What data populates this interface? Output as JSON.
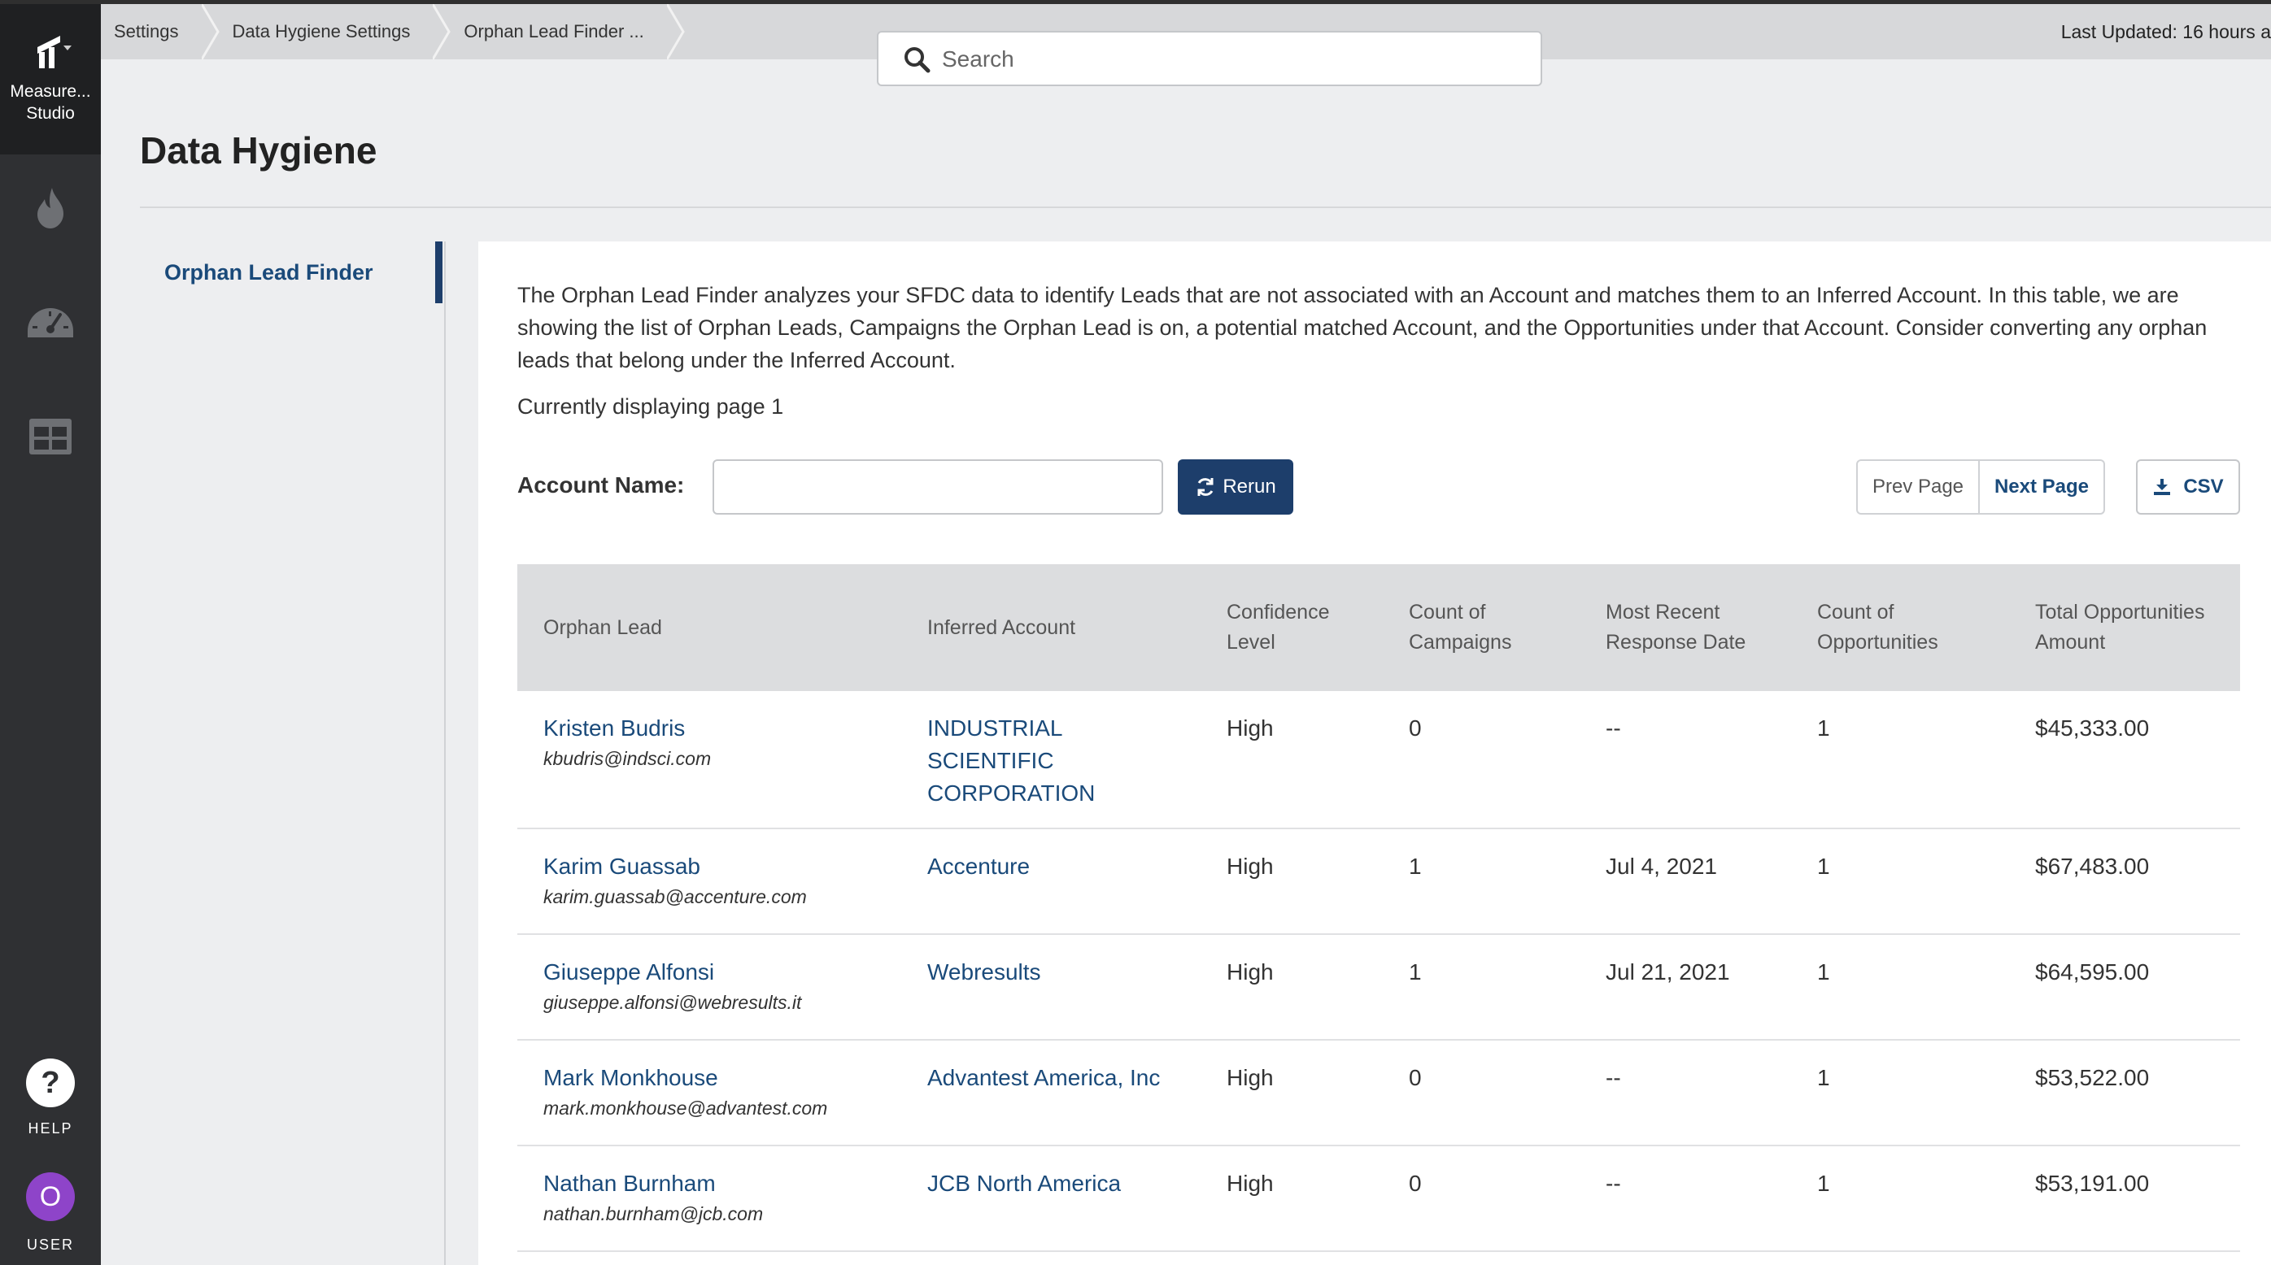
{
  "brand": {
    "name_line1": "Measure...",
    "name_line2": "Studio"
  },
  "rail": {
    "help_label": "HELP",
    "user_initial": "O",
    "user_label": "USER"
  },
  "breadcrumbs": [
    "Settings",
    "Data Hygiene Settings",
    "Orphan Lead Finder ..."
  ],
  "last_updated": "Last Updated: 16 hours a",
  "search": {
    "placeholder": "Search",
    "value": ""
  },
  "page_title": "Data Hygiene",
  "submenu": {
    "active_item": "Orphan Lead Finder"
  },
  "description": "The Orphan Lead Finder analyzes your SFDC data to identify Leads that are not associated with an Account and matches them to an Inferred Account. In this table, we are showing the list of Orphan Leads, Campaigns the Orphan Lead is on, a potential matched Account, and the Opportunities under that Account. Consider converting any orphan leads that belong under the Inferred Account.",
  "page_status": "Currently displaying page 1",
  "filters": {
    "account_label": "Account Name:",
    "account_value": "",
    "rerun_label": "Rerun"
  },
  "pagination": {
    "prev_label": "Prev Page",
    "next_label": "Next Page"
  },
  "export": {
    "csv_label": "CSV"
  },
  "table": {
    "columns": [
      "Orphan Lead",
      "Inferred Account",
      "Confidence Level",
      "Count of Campaigns",
      "Most Recent Response Date",
      "Count of Opportunities",
      "Total Opportunities Amount"
    ],
    "rows": [
      {
        "lead": "Kristen Budris",
        "email": "kbudris@indsci.com",
        "account": "INDUSTRIAL SCIENTIFIC CORPORATION",
        "confidence": "High",
        "campaigns": "0",
        "response_date": "--",
        "opportunities": "1",
        "amount": "$45,333.00"
      },
      {
        "lead": "Karim Guassab",
        "email": "karim.guassab@accenture.com",
        "account": "Accenture",
        "confidence": "High",
        "campaigns": "1",
        "response_date": "Jul 4, 2021",
        "opportunities": "1",
        "amount": "$67,483.00"
      },
      {
        "lead": "Giuseppe Alfonsi",
        "email": "giuseppe.alfonsi@webresults.it",
        "account": "Webresults",
        "confidence": "High",
        "campaigns": "1",
        "response_date": "Jul 21, 2021",
        "opportunities": "1",
        "amount": "$64,595.00"
      },
      {
        "lead": "Mark Monkhouse",
        "email": "mark.monkhouse@advantest.com",
        "account": "Advantest America, Inc",
        "confidence": "High",
        "campaigns": "0",
        "response_date": "--",
        "opportunities": "1",
        "amount": "$53,522.00"
      },
      {
        "lead": "Nathan Burnham",
        "email": "nathan.burnham@jcb.com",
        "account": "JCB North America",
        "confidence": "High",
        "campaigns": "0",
        "response_date": "--",
        "opportunities": "1",
        "amount": "$53,191.00"
      }
    ]
  },
  "icons": [
    "brand-logo-icon",
    "flame-icon",
    "gauge-icon",
    "table-icon",
    "search-icon",
    "refresh-icon",
    "download-icon"
  ]
}
